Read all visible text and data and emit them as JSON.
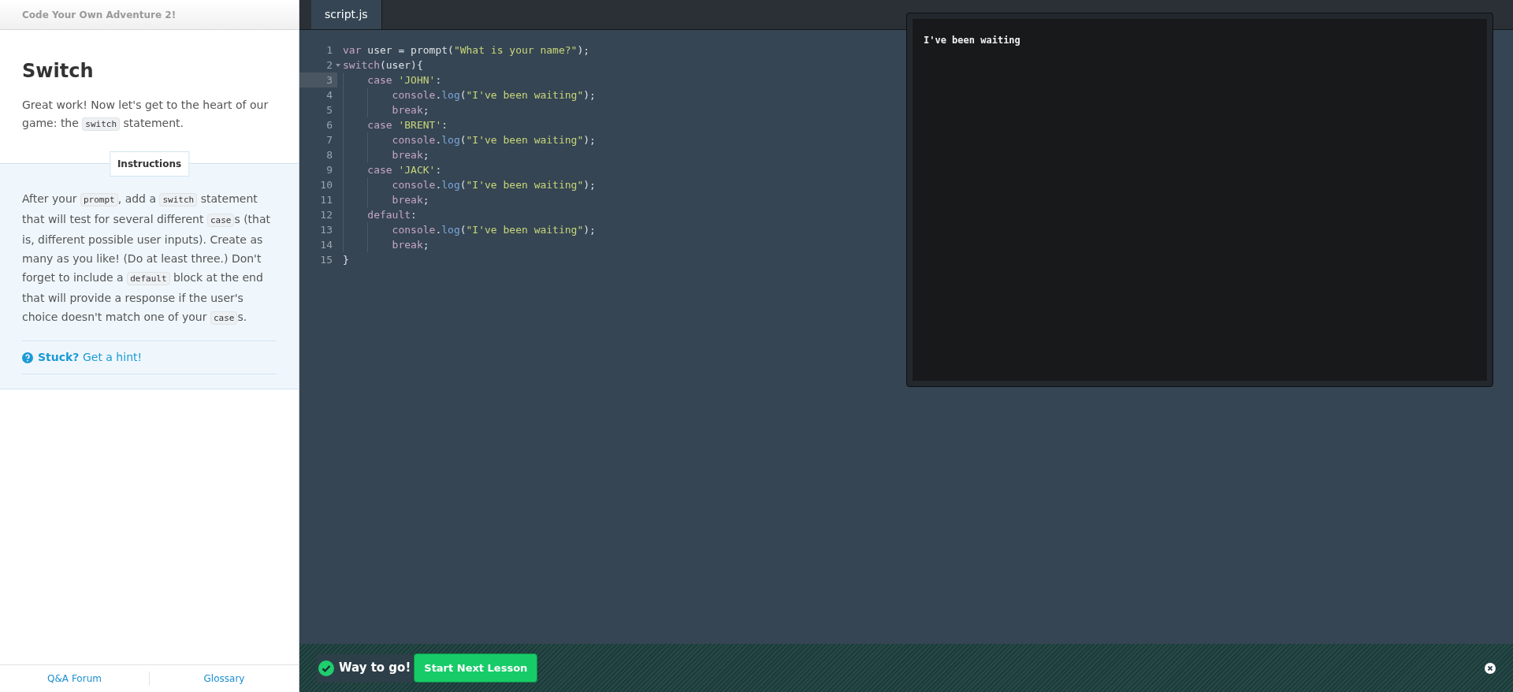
{
  "course_title": "Code Your Own Adventure 2!",
  "lesson": {
    "title": "Switch",
    "intro": [
      {
        "kind": "text",
        "text": "Great work! Now let's get to the heart of our game: the "
      },
      {
        "kind": "code",
        "text": "switch"
      },
      {
        "kind": "text",
        "text": " statement."
      }
    ]
  },
  "instructions": {
    "heading": "Instructions",
    "body": [
      {
        "kind": "text",
        "text": "After your "
      },
      {
        "kind": "code",
        "text": "prompt"
      },
      {
        "kind": "text",
        "text": ", add a "
      },
      {
        "kind": "code",
        "text": "switch"
      },
      {
        "kind": "text",
        "text": " statement that will test for several different "
      },
      {
        "kind": "code",
        "text": "case"
      },
      {
        "kind": "text",
        "text": "s (that is, different possible user inputs). Create as many as you like! (Do at least three.) Don't forget to include a "
      },
      {
        "kind": "code",
        "text": "default"
      },
      {
        "kind": "text",
        "text": " block at the end that will provide a response if the user's choice doesn't match one of your "
      },
      {
        "kind": "code",
        "text": "case"
      },
      {
        "kind": "text",
        "text": "s."
      }
    ],
    "hint": "**Stuck?** Get a hint!"
  },
  "footer_links": [
    "Q&A Forum",
    "Glossary"
  ],
  "editor": {
    "tabs": [
      {
        "label": "script.js",
        "selected": true
      }
    ],
    "lines": [
      {
        "number": "1",
        "selected": false,
        "foldable": false,
        "tokens": [
          {
            "kind": "keyword",
            "text": "var"
          },
          {
            "kind": "plain",
            "text": " user = prompt("
          },
          {
            "kind": "string",
            "text": "\"What is your name?\""
          },
          {
            "kind": "plain",
            "text": ");"
          }
        ]
      },
      {
        "number": "2",
        "selected": false,
        "foldable": true,
        "tokens": [
          {
            "kind": "keyword",
            "text": "switch"
          },
          {
            "kind": "plain",
            "text": "(user){"
          }
        ]
      },
      {
        "number": "3",
        "selected": true,
        "foldable": false,
        "tokens": [
          {
            "kind": "keyword",
            "text": "    case "
          },
          {
            "kind": "string",
            "text": "'JOHN'"
          },
          {
            "kind": "plain",
            "text": ":"
          }
        ]
      },
      {
        "number": "4",
        "selected": false,
        "foldable": false,
        "tokens": [
          {
            "kind": "keyword",
            "text": "        console"
          },
          {
            "kind": "plain",
            "text": "."
          },
          {
            "kind": "function",
            "text": "log"
          },
          {
            "kind": "plain",
            "text": "("
          },
          {
            "kind": "string",
            "text": "\"I've been waiting\""
          },
          {
            "kind": "plain",
            "text": ");"
          }
        ]
      },
      {
        "number": "5",
        "selected": false,
        "foldable": false,
        "tokens": [
          {
            "kind": "keyword",
            "text": "        break"
          },
          {
            "kind": "plain",
            "text": ";"
          }
        ]
      },
      {
        "number": "6",
        "selected": false,
        "foldable": false,
        "tokens": [
          {
            "kind": "keyword",
            "text": "    case "
          },
          {
            "kind": "string",
            "text": "'BRENT'"
          },
          {
            "kind": "plain",
            "text": ":"
          }
        ]
      },
      {
        "number": "7",
        "selected": false,
        "foldable": false,
        "tokens": [
          {
            "kind": "keyword",
            "text": "        console"
          },
          {
            "kind": "plain",
            "text": "."
          },
          {
            "kind": "function",
            "text": "log"
          },
          {
            "kind": "plain",
            "text": "("
          },
          {
            "kind": "string",
            "text": "\"I've been waiting\""
          },
          {
            "kind": "plain",
            "text": ");"
          }
        ]
      },
      {
        "number": "8",
        "selected": false,
        "foldable": false,
        "tokens": [
          {
            "kind": "keyword",
            "text": "        break"
          },
          {
            "kind": "plain",
            "text": ";"
          }
        ]
      },
      {
        "number": "9",
        "selected": false,
        "foldable": false,
        "tokens": [
          {
            "kind": "keyword",
            "text": "    case "
          },
          {
            "kind": "string",
            "text": "'JACK'"
          },
          {
            "kind": "plain",
            "text": ":"
          }
        ]
      },
      {
        "number": "10",
        "selected": false,
        "foldable": false,
        "tokens": [
          {
            "kind": "keyword",
            "text": "        console"
          },
          {
            "kind": "plain",
            "text": "."
          },
          {
            "kind": "function",
            "text": "log"
          },
          {
            "kind": "plain",
            "text": "("
          },
          {
            "kind": "string",
            "text": "\"I've been waiting\""
          },
          {
            "kind": "plain",
            "text": ");"
          }
        ]
      },
      {
        "number": "11",
        "selected": false,
        "foldable": false,
        "tokens": [
          {
            "kind": "keyword",
            "text": "        break"
          },
          {
            "kind": "plain",
            "text": ";"
          }
        ]
      },
      {
        "number": "12",
        "selected": false,
        "foldable": false,
        "tokens": [
          {
            "kind": "keyword",
            "text": "    default"
          },
          {
            "kind": "plain",
            "text": ":"
          }
        ]
      },
      {
        "number": "13",
        "selected": false,
        "foldable": false,
        "tokens": [
          {
            "kind": "keyword",
            "text": "        console"
          },
          {
            "kind": "plain",
            "text": "."
          },
          {
            "kind": "function",
            "text": "log"
          },
          {
            "kind": "plain",
            "text": "("
          },
          {
            "kind": "string",
            "text": "\"I've been waiting\""
          },
          {
            "kind": "plain",
            "text": ");"
          }
        ]
      },
      {
        "number": "14",
        "selected": false,
        "foldable": false,
        "tokens": [
          {
            "kind": "keyword",
            "text": "        break"
          },
          {
            "kind": "plain",
            "text": ";"
          }
        ]
      },
      {
        "number": "15",
        "selected": false,
        "foldable": false,
        "tokens": [
          {
            "kind": "plain",
            "text": "}"
          }
        ]
      }
    ]
  },
  "console": {
    "output": [
      "I've been waiting"
    ]
  },
  "success_bar": {
    "message": "Way to go!",
    "button": "Start Next Lesson"
  }
}
